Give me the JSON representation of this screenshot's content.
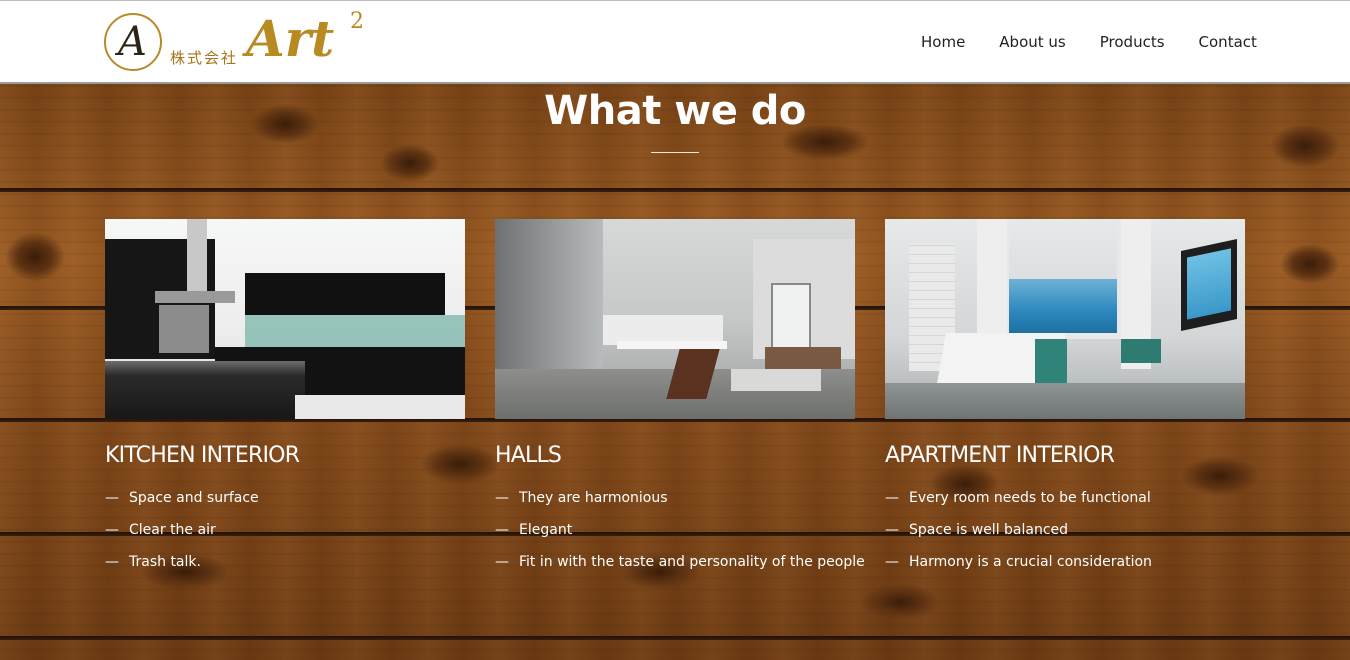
{
  "brand": {
    "logo_letter": "A",
    "logo_japanese": "株式会社",
    "logo_name": "Art",
    "logo_superscript": "2"
  },
  "nav": {
    "items": [
      "Home",
      "About us",
      "Products",
      "Contact"
    ]
  },
  "section": {
    "title": "What we do"
  },
  "cards": [
    {
      "title": "KITCHEN INTERIOR",
      "image_alt": "kitchen photo",
      "items": [
        "Space and surface",
        "Clear the air",
        "Trash talk."
      ]
    },
    {
      "title": "HALLS",
      "image_alt": "hall photo",
      "items": [
        "They are harmonious",
        "Elegant",
        "Fit in with the taste and personality of the people"
      ]
    },
    {
      "title": "APARTMENT INTERIOR",
      "image_alt": "apartment photo",
      "items": [
        "Every room needs to be functional",
        "Space is well balanced",
        "Harmony is a crucial consideration"
      ]
    }
  ],
  "list_dash": "—",
  "colors": {
    "accent_gold": "#b88a22",
    "wood": "#8a4d1c",
    "text_light": "#ffffff"
  }
}
